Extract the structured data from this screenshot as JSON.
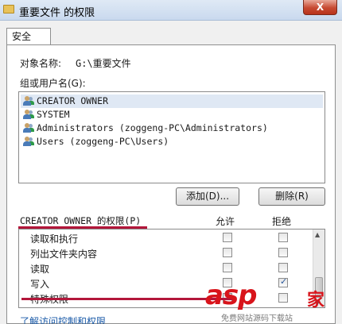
{
  "window": {
    "title": "重要文件 的权限",
    "close_label": "X"
  },
  "tabs": [
    {
      "label": "安全"
    }
  ],
  "object": {
    "label": "对象名称:",
    "value": "G:\\重要文件"
  },
  "groups": {
    "label": "组或用户名(G):",
    "users": [
      {
        "name": "CREATOR OWNER",
        "selected": true
      },
      {
        "name": "SYSTEM",
        "selected": false
      },
      {
        "name": "Administrators (zoggeng-PC\\Administrators)",
        "selected": false
      },
      {
        "name": "Users (zoggeng-PC\\Users)",
        "selected": false
      }
    ]
  },
  "buttons": {
    "add": "添加(D)...",
    "remove": "删除(R)"
  },
  "permissions": {
    "label": "CREATOR OWNER 的权限(P)",
    "allow_header": "允许",
    "deny_header": "拒绝",
    "rows": [
      {
        "name": "读取和执行",
        "allow": false,
        "deny": false
      },
      {
        "name": "列出文件夹内容",
        "allow": false,
        "deny": false
      },
      {
        "name": "读取",
        "allow": false,
        "deny": false
      },
      {
        "name": "写入",
        "allow": false,
        "deny": true
      },
      {
        "name": "特殊权限",
        "allow": false,
        "deny": false
      }
    ]
  },
  "link": "了解访问控制和权限",
  "watermark": {
    "brand": "asp",
    "cn": "家",
    "sub": "免费网站源码下载站"
  },
  "colors": {
    "accent_red": "#b3163a",
    "link": "#1a5aa8",
    "selection": "#dfe8f4"
  }
}
